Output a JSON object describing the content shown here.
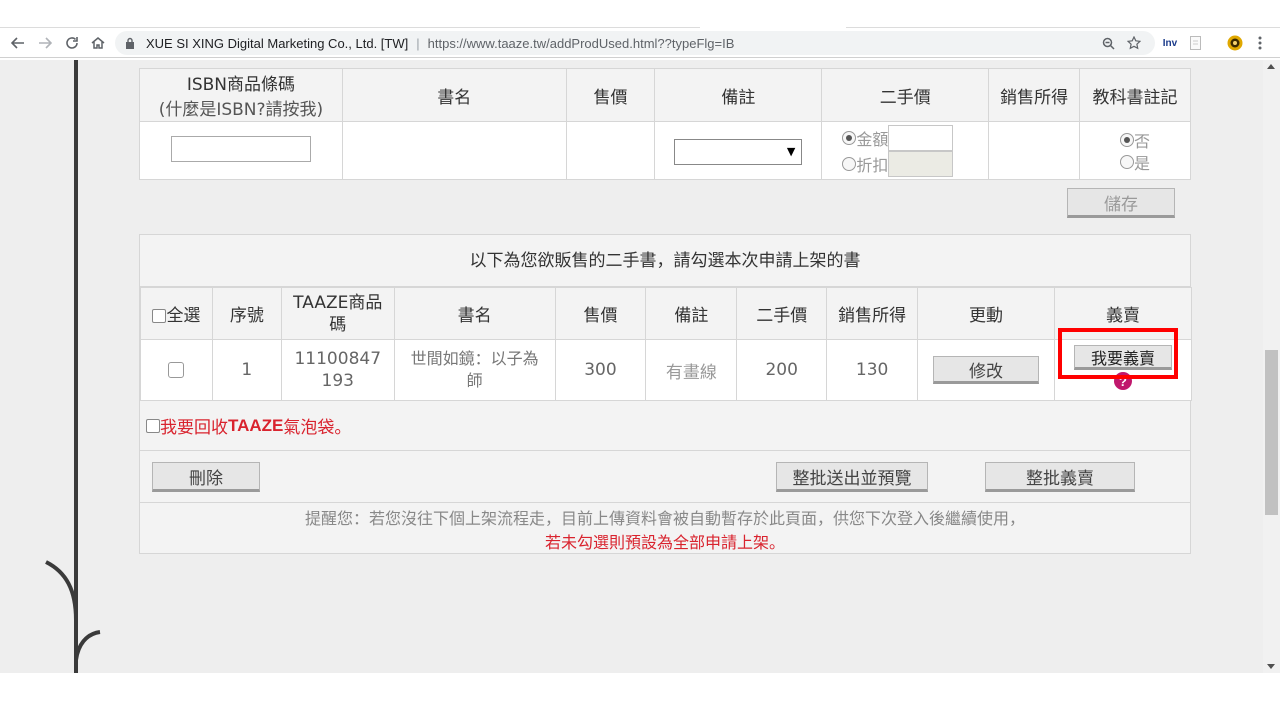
{
  "browser": {
    "site_name": "XUE SI XING Digital Marketing Co., Ltd. [TW]",
    "separator": "|",
    "url": "https://www.taaze.tw/addProdUsed.html??typeFlg=IB",
    "ext_label": "Inv"
  },
  "form_table": {
    "headers": {
      "isbn_line1": "ISBN商品條碼",
      "isbn_line2": "(什麼是ISBN?請按我)",
      "title": "書名",
      "price": "售價",
      "remark": "備註",
      "used_price": "二手價",
      "sales_income": "銷售所得",
      "textbook": "教科書註記"
    },
    "remark_select_value": "",
    "price_options": {
      "amount": "金額",
      "discount": "折扣"
    },
    "textbook_options": {
      "no": "否",
      "yes": "是"
    },
    "save_label": "儲存"
  },
  "sell_panel": {
    "title": "以下為您欲販售的二手書，請勾選本次申請上架的書",
    "headers": {
      "select_all": "全選",
      "seq": "序號",
      "taaze_code": "TAAZE商品碼",
      "title": "書名",
      "price": "售價",
      "remark": "備註",
      "used_price": "二手價",
      "sales_income": "銷售所得",
      "modify": "更動",
      "charity": "義賣"
    },
    "rows": [
      {
        "seq": "1",
        "code": "11100847193",
        "title": "世間如鏡：以子為師",
        "price": "300",
        "remark": "有畫線",
        "used_price": "200",
        "sales_income": "130",
        "modify_label": "修改",
        "charity_label": "我要義賣",
        "help_mark": "?"
      }
    ],
    "bubble_prefix": "我要回收",
    "bubble_brand": "TAAZE",
    "bubble_suffix": "氣泡袋。",
    "delete_label": "刪除",
    "batch_preview_label": "整批送出並預覽",
    "batch_charity_label": "整批義賣",
    "reminder_line1": "提醒您：若您沒往下個上架流程走，目前上傳資料會被自動暫存於此頁面，供您下次登入後繼續使用，",
    "reminder_line2": "若未勾選則預設為全部申請上架。"
  },
  "colors": {
    "highlight": "#ff0000",
    "warning_text": "#d9232e",
    "help_icon": "#c0186d",
    "page_bg": "#eeeeee"
  }
}
